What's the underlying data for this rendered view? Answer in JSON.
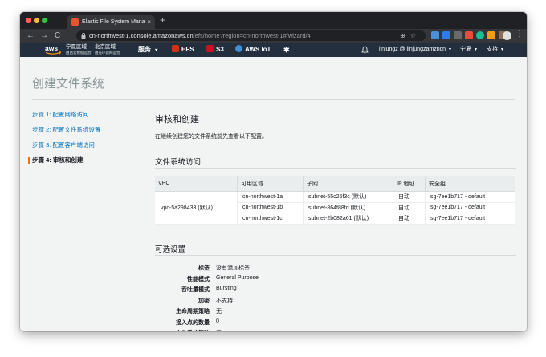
{
  "browser": {
    "tab_title": "Elastic File System Manageme",
    "tab_close": "×",
    "new_tab": "+",
    "url_host": "cn-northwest-1.console.amazonaws.cn",
    "url_path": "/efs/home?region=cn-northwest-1#/wizard/4",
    "nav_back": "←",
    "nav_forward": "→",
    "nav_reload": "C",
    "url_icons": "⊕☆",
    "kebab": "⋮"
  },
  "aws_nav": {
    "logo": "aws",
    "region1_name": "宁夏区域",
    "region1_sub": "由西云数据运营",
    "region2_name": "北京区域",
    "region2_sub": "由光环新网运营",
    "services": "服务",
    "efs": "EFS",
    "s3": "S3",
    "iot": "AWS IoT",
    "account": "linjungz @ linjungzamzncn",
    "region": "宁夏",
    "support": "支持",
    "caret": "▾",
    "pin": "✱",
    "bell": "🔔"
  },
  "page": {
    "title": "创建文件系统",
    "steps": [
      {
        "label": "步骤 1: 配置网络访问"
      },
      {
        "label": "步骤 2: 配置文件系统设置"
      },
      {
        "label": "步骤 3: 配置客户端访问"
      },
      {
        "label": "步骤 4: 审核和创建"
      }
    ],
    "heading": "审核和创建",
    "intro": "在继续创建您的文件系统前先查看以下配置。",
    "access_heading": "文件系统访问",
    "table": {
      "headers": [
        "VPC",
        "可用区域",
        "子网",
        "IP 地址",
        "安全组"
      ],
      "vpc": "vpc-5a298433 (默认)",
      "rows": [
        {
          "az": "cn-northwest-1a",
          "subnet": "subnet-55c26f3c (默认)",
          "ip": "自动",
          "sg": "sg-7ee1b717 - default"
        },
        {
          "az": "cn-northwest-1b",
          "subnet": "subnet-864f88fd (默认)",
          "ip": "自动",
          "sg": "sg-7ee1b717 - default"
        },
        {
          "az": "cn-northwest-1c",
          "subnet": "subnet-2b082a61 (默认)",
          "ip": "自动",
          "sg": "sg-7ee1b717 - default"
        }
      ]
    },
    "optional_heading": "可选设置",
    "optional": [
      {
        "key": "标签",
        "value": "没有添加标签"
      },
      {
        "key": "性能模式",
        "value": "General Purpose"
      },
      {
        "key": "吞吐量模式",
        "value": "Bursting"
      },
      {
        "key": "加密",
        "value": "不支持"
      },
      {
        "key": "生命周期策略",
        "value": "无"
      },
      {
        "key": "接入点的数量",
        "value": "0"
      },
      {
        "key": "文件系统策略",
        "value": "无"
      }
    ]
  },
  "colors": {
    "aws_nav_bg": "#232f3e",
    "link": "#0073bb",
    "active_step_marker": "#ec7211",
    "aws_orange": "#ff9900"
  }
}
